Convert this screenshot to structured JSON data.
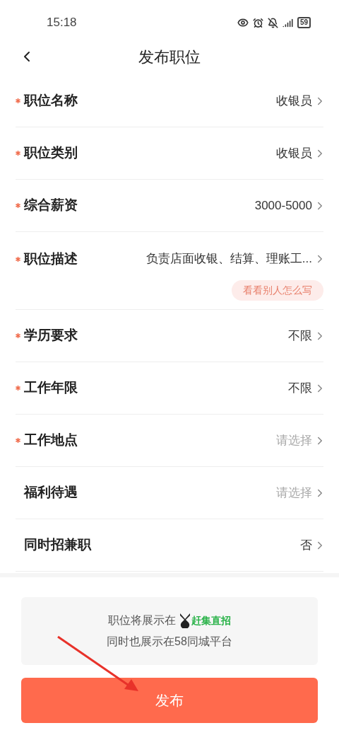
{
  "status_bar": {
    "time": "15:18",
    "battery": "59"
  },
  "header": {
    "title": "发布职位"
  },
  "fields": [
    {
      "label": "职位名称",
      "required": true,
      "value": "收银员"
    },
    {
      "label": "职位类别",
      "required": true,
      "value": "收银员"
    },
    {
      "label": "综合薪资",
      "required": true,
      "value": "3000-5000"
    },
    {
      "label": "职位描述",
      "required": true,
      "value": "负责店面收银、结算、理账工...",
      "hint": "看看别人怎么写"
    },
    {
      "label": "学历要求",
      "required": true,
      "value": "不限"
    },
    {
      "label": "工作年限",
      "required": true,
      "value": "不限"
    },
    {
      "label": "工作地点",
      "required": true,
      "placeholder": "请选择"
    },
    {
      "label": "福利待遇",
      "required": false,
      "placeholder": "请选择"
    },
    {
      "label": "同时招兼职",
      "required": false,
      "value": "否"
    }
  ],
  "notice": {
    "line_1": "职位将展示在",
    "brand": "赶集直招",
    "line_2": "同时也展示在58同城平台"
  },
  "publish_button": "发布"
}
